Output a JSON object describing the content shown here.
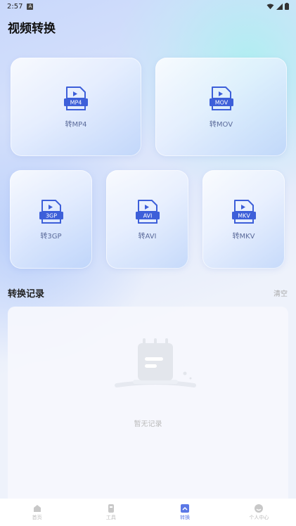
{
  "status": {
    "time": "2:57",
    "notif": "A"
  },
  "page_title": "视频转换",
  "formats_large": [
    {
      "tag": "MP4",
      "label": "转MP4"
    },
    {
      "tag": "MOV",
      "label": "转MOV"
    }
  ],
  "formats_small": [
    {
      "tag": "3GP",
      "label": "转3GP"
    },
    {
      "tag": "AVI",
      "label": "转AVI"
    },
    {
      "tag": "MKV",
      "label": "转MKV"
    }
  ],
  "history": {
    "title": "转换记录",
    "clear_label": "清空",
    "empty_text": "暂无记录"
  },
  "tabs": [
    {
      "label": "首页",
      "icon": "home-icon",
      "active": false
    },
    {
      "label": "工具",
      "icon": "tools-icon",
      "active": false
    },
    {
      "label": "转换",
      "icon": "convert-icon",
      "active": true
    },
    {
      "label": "个人中心",
      "icon": "profile-icon",
      "active": false
    }
  ],
  "colors": {
    "accent": "#4a68e0",
    "icon_blue": "#3d5fd9"
  }
}
